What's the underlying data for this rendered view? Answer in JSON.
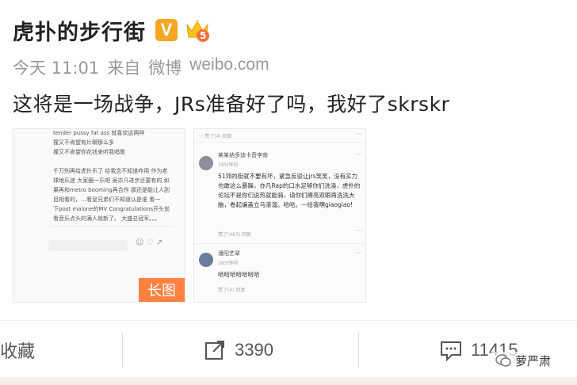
{
  "post": {
    "username": "虎扑的步行街",
    "verified_badge": "V",
    "member_level_badge": "5",
    "time": "今天 11:01",
    "source_prefix": "来自",
    "source_app": "微博",
    "source_site": "weibo.com",
    "text": "这将是一场战争，JRs准备好了吗，我好了skrskr"
  },
  "images": {
    "image1": {
      "lines": [
        "tender pussy fat ass 就喜欢这两样",
        "撞又不肯望有片聊那么多",
        "撞又不肯望你花钱来听我唱歌",
        "",
        "千万别再给虎扑乐了 给我念不知道咋用 作为老",
        "球地乐迷 大家圈一乐吧 吴亦凡进步还要有的 如",
        "果再和metro booming再合作 那还是能让人刮",
        "目相看的，…看呈兄弟们不知道认是谁 看一",
        "下post malone的MV Congratulations开头前",
        "看音乐点头的满人就新了。 大盛总冠军。。。"
      ],
      "badge": "长图"
    },
    "image2": {
      "c1_name": "某某纳多迪卡音李南",
      "c1_sub": "28分钟前",
      "c1_body": "51郊的街就不要有坏，紧急反驳让jrs笑笑，没有实力也敢这么暴躁，亦凡Rap的口水足够你们洗澡，虎扑的论坛不是你们说热就能骑，请你们擦亮双眼再洗洗大脑，卷起编盖立马滚溜。哈哈。一给我嘿giaogiao!",
      "c1_acts": "赞了(487)    回复",
      "c2_name": "潘阳艺翠",
      "c2_sub": "28分钟前",
      "c2_body": "哈哈哈哈哈哈哈",
      "c2_acts": "赞了(4)    回复"
    }
  },
  "actions": {
    "favorite_label": "收藏",
    "repost_count": "3390",
    "comment_count": "11415"
  },
  "watermark": {
    "text": "萝严肃"
  },
  "colors": {
    "accent_orange": "#ff8140",
    "verified_yellow": "#f5a623",
    "meta_gray": "#999999"
  }
}
